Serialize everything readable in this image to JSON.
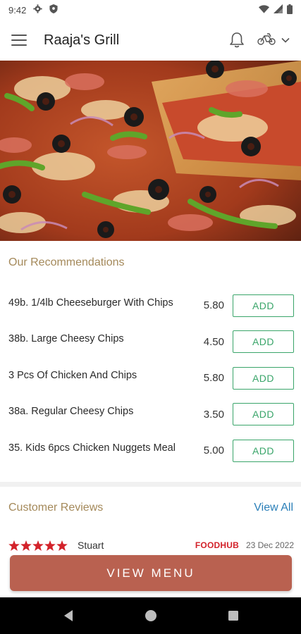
{
  "status_bar": {
    "time": "9:42",
    "icons": [
      "gear-icon",
      "shield-icon",
      "wifi-icon",
      "signal-icon",
      "battery-icon"
    ]
  },
  "app_bar": {
    "title": "Raaja's Grill",
    "icons": [
      "menu-icon",
      "bell-icon",
      "bike-icon",
      "chevron-down-icon"
    ]
  },
  "hero": {
    "image": "pizza-photo"
  },
  "recommendations": {
    "title": "Our Recommendations",
    "add_label": "ADD",
    "items": [
      {
        "name": "49b. 1/4lb Cheeseburger With Chips",
        "price": "5.80"
      },
      {
        "name": "38b. Large Cheesy Chips",
        "price": "4.50"
      },
      {
        "name": "3 Pcs Of Chicken And Chips",
        "price": "5.80"
      },
      {
        "name": "38a. Regular Cheesy Chips",
        "price": "3.50"
      },
      {
        "name": "35. Kids 6pcs Chicken Nuggets Meal",
        "price": "5.00"
      }
    ]
  },
  "reviews": {
    "title": "Customer Reviews",
    "view_all_label": "View All",
    "items": [
      {
        "rating": 5,
        "reviewer": "Stuart",
        "source": "FOODHUB",
        "date": "23 Dec 2022"
      }
    ]
  },
  "view_menu_label": "VIEW MENU",
  "nav_bar": {
    "icons": [
      "back-icon",
      "home-icon",
      "recents-icon"
    ]
  },
  "colors": {
    "accent_gold": "#a4895a",
    "add_green": "#3aa56a",
    "link_blue": "#2a7fb8",
    "button_terracotta": "#b96150",
    "star_red": "#d3222a"
  }
}
